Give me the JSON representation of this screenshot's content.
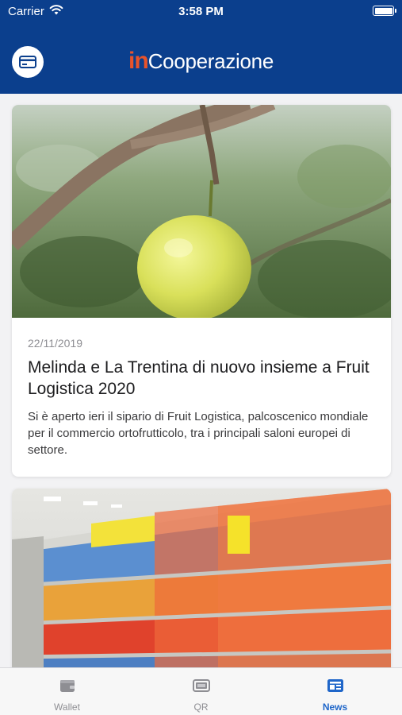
{
  "status_bar": {
    "carrier": "Carrier",
    "time": "3:58 PM"
  },
  "header": {
    "logo_prefix": "in",
    "logo_name": "Cooperazione",
    "wallet_button_icon": "card-icon"
  },
  "colors": {
    "brand_blue": "#0b3f8d",
    "logo_accent": "#e8532b",
    "tab_active": "#1f66c9",
    "tab_inactive": "#8e8e93"
  },
  "feed": {
    "articles": [
      {
        "date": "22/11/2019",
        "title": "Melinda e La Trentina di nuovo insieme a Fruit Logistica 2020",
        "excerpt": "Si è aperto ieri il sipario di Fruit Logistica, palcoscenico mondiale per il commercio ortofrutticolo, tra i principali saloni europei di settore.",
        "image": "green-apple-on-branch-photo"
      },
      {
        "image": "supermarket-shelves-photo"
      }
    ]
  },
  "tab_bar": {
    "tabs": [
      {
        "label": "Wallet",
        "icon": "wallet-icon",
        "active": false
      },
      {
        "label": "QR",
        "icon": "qr-card-icon",
        "active": false
      },
      {
        "label": "News",
        "icon": "news-icon",
        "active": true
      }
    ]
  }
}
